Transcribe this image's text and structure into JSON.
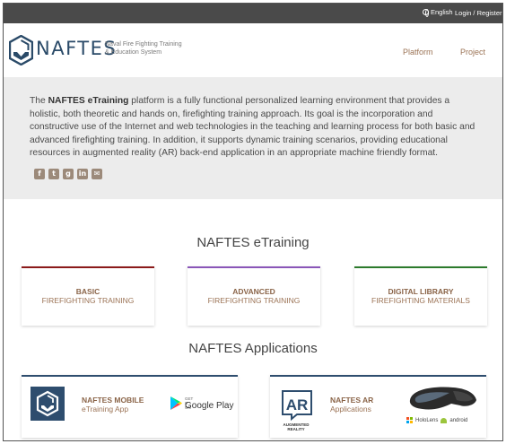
{
  "topbar": {
    "language": "English",
    "login": "Login / Register"
  },
  "header": {
    "logo_word": "NAFTES",
    "logo_tagline_1": "Naval Fire Fighting Training",
    "logo_tagline_2": "& Education System",
    "nav": {
      "platform": "Platform",
      "project": "Project"
    }
  },
  "intro": {
    "prefix": "The ",
    "brand": "NAFTES eTraining",
    "text": " platform is a fully functional personalized learning environment that provides a holistic, both theoretic and hands on, firefighting training approach. Its goal is the incorporation and constructive use of the Internet and web technologies in the teaching and learning process for both basic and advanced firefighting training. In addition, it supports dynamic training scenarios, providing educational resources in augmented reality (AR) back-end application in an appropriate machine friendly format.",
    "social": [
      "facebook-icon",
      "twitter-icon",
      "googleplus-icon",
      "linkedin-icon",
      "email-icon"
    ]
  },
  "etraining": {
    "title": "NAFTES eTraining",
    "cards": [
      {
        "line1": "BASIC",
        "line2": "FIREFIGHTING TRAINING",
        "accent": "#8b1a1a"
      },
      {
        "line1": "ADVANCED",
        "line2": "FIREFIGHTING TRAINING",
        "accent": "#8a56b8"
      },
      {
        "line1": "DIGITAL LIBRARY",
        "line2": "FIREFIGHTING MATERIALS",
        "accent": "#2c7a2c"
      }
    ]
  },
  "applications": {
    "title": "NAFTES Applications",
    "mobile": {
      "name": "NAFTES MOBILE",
      "sub": "eTraining App",
      "store_small": "GET IT ON",
      "store_big": "Google Play"
    },
    "ar": {
      "badge": "AR",
      "badge_sub_1": "AUGMENTED",
      "badge_sub_2": "REALITY",
      "name": "NAFTES AR",
      "sub": "Applications",
      "platform_1": "HoloLens",
      "platform_2": "android"
    }
  },
  "colors": {
    "navy": "#2e4d6e",
    "tan": "#9b7355",
    "topbar": "#4a4a4a"
  }
}
